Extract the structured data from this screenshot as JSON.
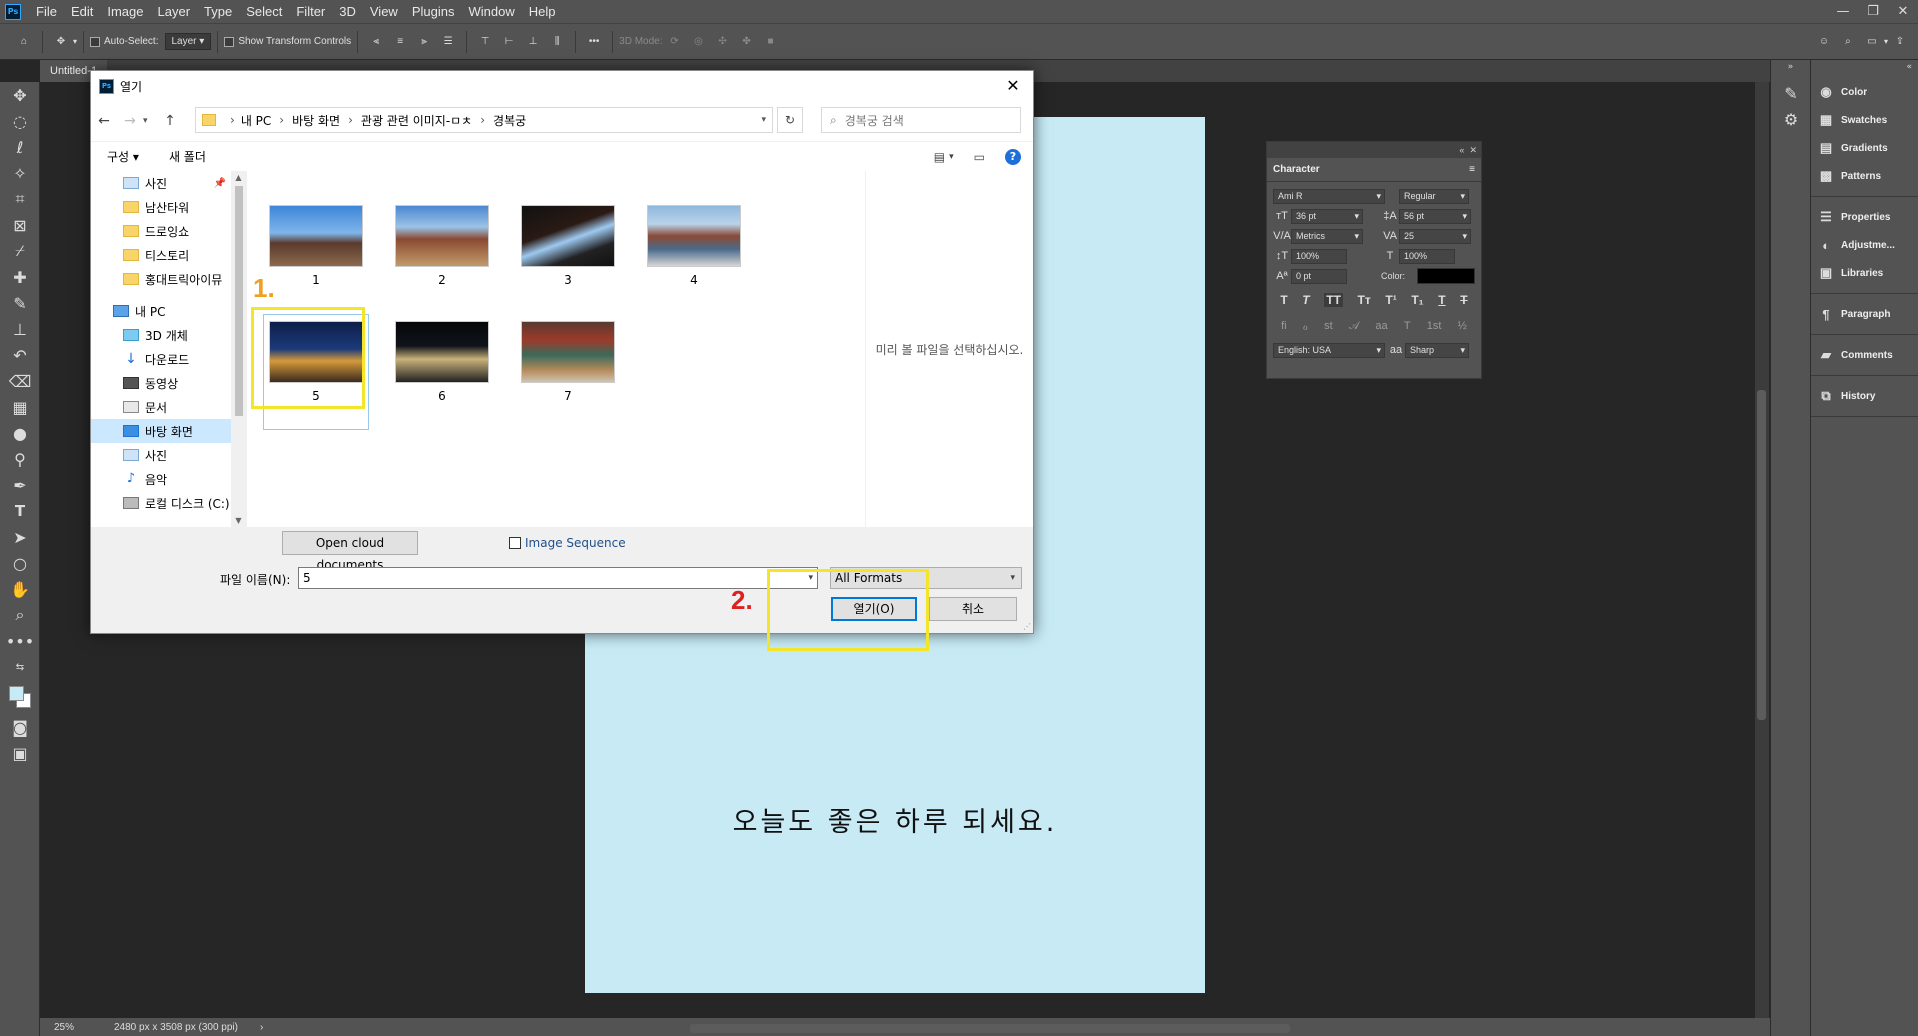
{
  "app": {
    "logo_text": "Ps",
    "menus": [
      "File",
      "Edit",
      "Image",
      "Layer",
      "Type",
      "Select",
      "Filter",
      "3D",
      "View",
      "Plugins",
      "Window",
      "Help"
    ]
  },
  "options_bar": {
    "auto_select_label": "Auto-Select:",
    "auto_select_value": "Layer",
    "transform_label": "Show Transform Controls",
    "mode_3d_label": "3D Mode:"
  },
  "document": {
    "tab_title": "Untitled-1",
    "canvas_text": "오늘도 좋은 하루 되세요.",
    "canvas_color": "#c7eaf5"
  },
  "status": {
    "zoom": "25%",
    "dimensions": "2480 px x 3508 px (300 ppi)"
  },
  "character_panel": {
    "title": "Character",
    "font_family": "Ami R",
    "font_style": "Regular",
    "font_size": "36 pt",
    "leading": "56 pt",
    "kerning": "Metrics",
    "tracking": "25",
    "vertical_scale": "100%",
    "horizontal_scale": "100%",
    "baseline_shift": "0 pt",
    "color_label": "Color:",
    "language": "English: USA",
    "aa_label": "aa",
    "antialias": "Sharp"
  },
  "right_panels": {
    "group1": [
      "Color",
      "Swatches",
      "Gradients",
      "Patterns"
    ],
    "group2": [
      "Properties",
      "Adjustme...",
      "Libraries"
    ],
    "group3": [
      "Paragraph"
    ],
    "group4": [
      "Comments"
    ],
    "group5": [
      "History"
    ]
  },
  "dialog": {
    "title": "열기",
    "breadcrumb": [
      "내 PC",
      "바탕 화면",
      "관광 관련 이미지-ㅁㅊ",
      "경복궁"
    ],
    "search_placeholder": "경복궁 검색",
    "organize_label": "구성",
    "new_folder_label": "새 폴더",
    "nav_items": [
      "사진",
      "남산타워",
      "드로잉쇼",
      "티스토리",
      "홍대트릭아이뮤",
      "내 PC",
      "3D 개체",
      "다운로드",
      "동영상",
      "문서",
      "바탕 화면",
      "사진",
      "음악",
      "로컬 디스크 (C:)"
    ],
    "files": [
      "1",
      "2",
      "3",
      "4",
      "5",
      "6",
      "7"
    ],
    "preview_text": "미리 볼 파일을 선택하십시오.",
    "cloud_button": "Open cloud documents",
    "image_sequence_label": "Image Sequence",
    "filename_label": "파일 이름(N):",
    "filename_value": "5",
    "format_value": "All Formats",
    "open_button": "열기(O)",
    "cancel_button": "취소",
    "annotation_1": "1.",
    "annotation_2": "2."
  }
}
